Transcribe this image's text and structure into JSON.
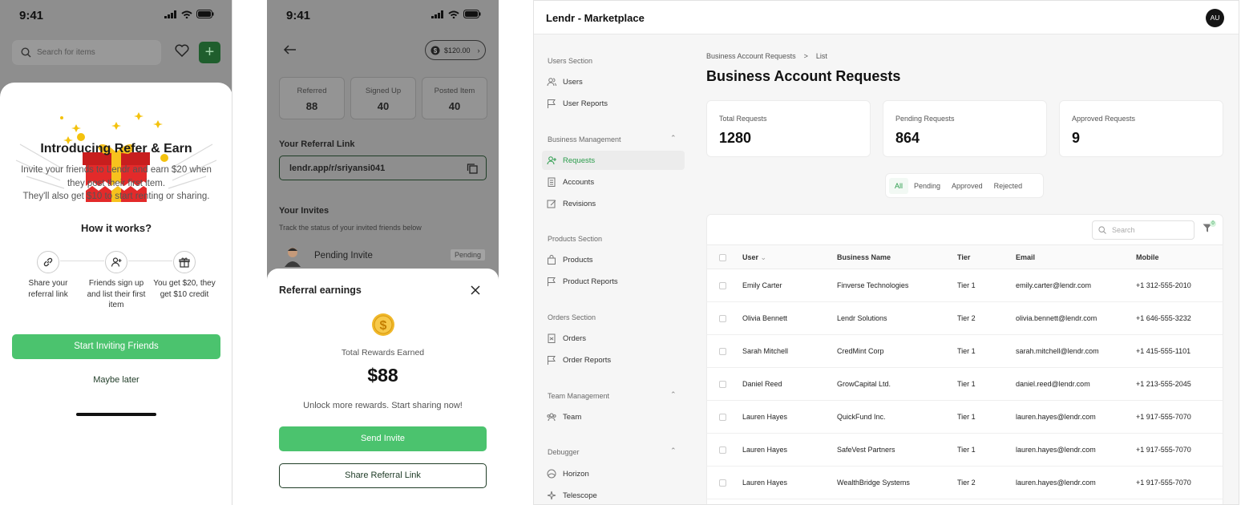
{
  "phone1": {
    "time": "9:41",
    "search_placeholder": "Search for items",
    "plus": "+",
    "title": "Introducing Refer & Earn",
    "description_line1": "Invite your friends to Lendr and earn $20 when they post their first item.",
    "description_line2": "They'll also get $10 to start renting or sharing.",
    "how_title": "How it works?",
    "steps": [
      {
        "icon": "link-icon",
        "label": "Share your referral link"
      },
      {
        "icon": "user-plus-icon",
        "label": "Friends sign up and list their first item"
      },
      {
        "icon": "gift-icon",
        "label": "You get $20, they get $10 credit"
      }
    ],
    "cta": "Start Inviting Friends",
    "later": "Maybe later"
  },
  "phone2": {
    "time": "9:41",
    "balance": "$120.00",
    "stats": [
      {
        "label": "Referred",
        "value": "88"
      },
      {
        "label": "Signed Up",
        "value": "40"
      },
      {
        "label": "Posted Item",
        "value": "40"
      }
    ],
    "referral_label": "Your Referral Link",
    "referral_link": "lendr.app/r/sriyansi041",
    "invites_label": "Your Invites",
    "invites_sub": "Track the status of your invited friends below",
    "invite_name": "Pending Invite",
    "invite_status": "Pending",
    "sheet_title": "Referral earnings",
    "total_label": "Total Rewards Earned",
    "total_value": "$88",
    "unlock": "Unlock more rewards. Start sharing now!",
    "send": "Send Invite",
    "share": "Share Referral Link"
  },
  "admin": {
    "brand": "Lendr - Marketplace",
    "avatar": "AU",
    "sections": {
      "users": "Users Section",
      "business": "Business Management",
      "products": "Products Section",
      "orders": "Orders Section",
      "team": "Team Management",
      "debugger": "Debugger"
    },
    "nav": {
      "users": "Users",
      "user_reports": "User Reports",
      "requests": "Requests",
      "accounts": "Accounts",
      "revisions": "Revisions",
      "products": "Products",
      "product_reports": "Product Reports",
      "orders": "Orders",
      "order_reports": "Order Reports",
      "team": "Team",
      "horizon": "Horizon",
      "telescope": "Telescope"
    },
    "breadcrumb": [
      "Business Account Requests",
      ">",
      "List"
    ],
    "title": "Business Account Requests",
    "cards": [
      {
        "label": "Total Requests",
        "value": "1280"
      },
      {
        "label": "Pending Requests",
        "value": "864"
      },
      {
        "label": "Approved Requests",
        "value": "9"
      }
    ],
    "filters": [
      "All",
      "Pending",
      "Approved",
      "Rejected"
    ],
    "search_placeholder": "Search",
    "filter_count": "0",
    "columns": [
      "User",
      "Business Name",
      "Tier",
      "Email",
      "Mobile"
    ],
    "rows": [
      {
        "user": "Emily Carter",
        "business": "Finverse Technologies",
        "tier": "Tier 1",
        "email": "emily.carter@lendr.com",
        "mobile": "+1 312-555-2010"
      },
      {
        "user": "Olivia Bennett",
        "business": "Lendr Solutions",
        "tier": "Tier 2",
        "email": "olivia.bennett@lendr.com",
        "mobile": "+1 646-555-3232"
      },
      {
        "user": "Sarah Mitchell",
        "business": "CredMint Corp",
        "tier": "Tier 1",
        "email": "sarah.mitchell@lendr.com",
        "mobile": "+1 415-555-1101"
      },
      {
        "user": "Daniel Reed",
        "business": "GrowCapital Ltd.",
        "tier": "Tier 1",
        "email": "daniel.reed@lendr.com",
        "mobile": "+1 213-555-2045"
      },
      {
        "user": "Lauren Hayes",
        "business": "QuickFund Inc.",
        "tier": "Tier 1",
        "email": "lauren.hayes@lendr.com",
        "mobile": "+1 917-555-7070"
      },
      {
        "user": "Lauren Hayes",
        "business": "SafeVest Partners",
        "tier": "Tier 1",
        "email": "lauren.hayes@lendr.com",
        "mobile": "+1 917-555-7070"
      },
      {
        "user": "Lauren Hayes",
        "business": "WealthBridge Systems",
        "tier": "Tier 2",
        "email": "lauren.hayes@lendr.com",
        "mobile": "+1 917-555-7070"
      }
    ]
  },
  "colors": {
    "accent": "#4bc36e",
    "dark_green": "#1f5e2d",
    "active_nav": "#2a9c4b"
  }
}
